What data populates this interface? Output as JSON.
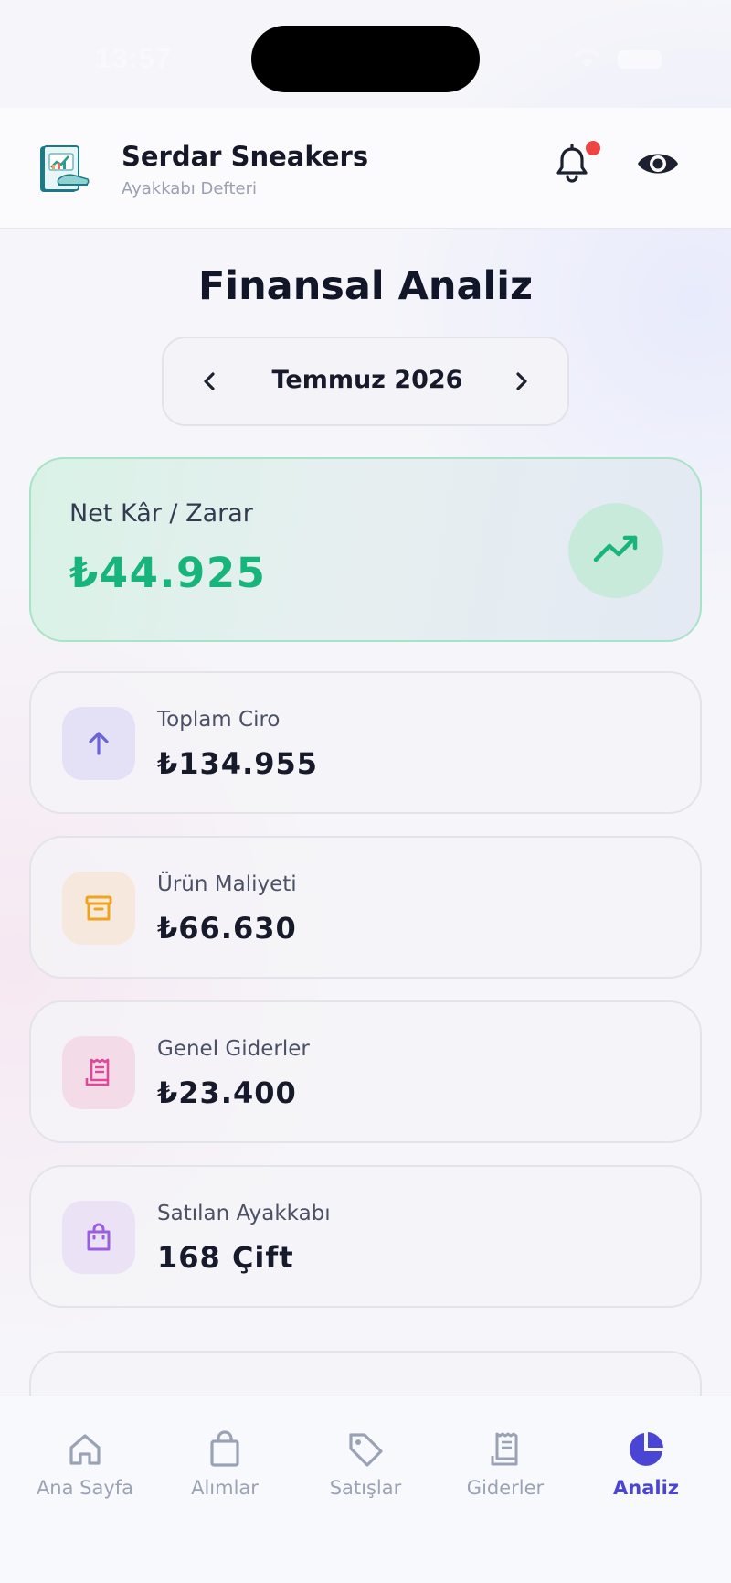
{
  "status_bar": {
    "time": "13:57"
  },
  "header": {
    "app_name": "Serdar Sneakers",
    "app_subtitle": "Ayakkabı Defteri",
    "icons": [
      "app-logo",
      "bell-icon",
      "eye-icon"
    ],
    "notification_dot": true
  },
  "page": {
    "title": "Finansal Analiz",
    "month": "Temmuz 2026"
  },
  "net": {
    "label": "Net Kâr / Zarar",
    "value": "₺44.925",
    "color": "#17b47c"
  },
  "stats": [
    {
      "label": "Toplam Ciro",
      "value": "₺134.955",
      "icon": "arrow-up-icon",
      "color": "#6b63d8"
    },
    {
      "label": "Ürün Maliyeti",
      "value": "₺66.630",
      "icon": "archive-box-icon",
      "color": "#f0a31d"
    },
    {
      "label": "Genel Giderler",
      "value": "₺23.400",
      "icon": "receipt-icon",
      "color": "#e0489a"
    },
    {
      "label": "Satılan Ayakkabı",
      "value": "168 Çift",
      "icon": "shopping-bag-icon",
      "color": "#9b5ee0"
    }
  ],
  "tabs": [
    {
      "label": "Ana Sayfa",
      "icon": "home-icon",
      "active": false
    },
    {
      "label": "Alımlar",
      "icon": "bag-icon",
      "active": false
    },
    {
      "label": "Satışlar",
      "icon": "tag-icon",
      "active": false
    },
    {
      "label": "Giderler",
      "icon": "receipt-icon",
      "active": false
    },
    {
      "label": "Analiz",
      "icon": "pie-chart-icon",
      "active": true
    }
  ],
  "colors": {
    "accent": "#4b45d6",
    "danger_dot": "#ef4444"
  }
}
